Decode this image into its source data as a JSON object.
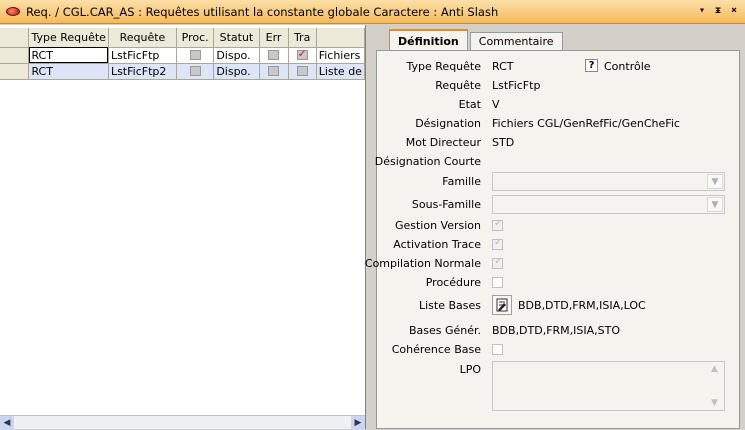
{
  "window": {
    "title": "Req. / CGL.CAR_AS : Requêtes utilisant la constante globale Caractere : Anti Slash",
    "buttons": [
      "▾",
      "ᵻ",
      "×"
    ]
  },
  "grid": {
    "columns": [
      "Type Requête",
      "Requête",
      "Proc.",
      "Statut",
      "Err",
      "Tra",
      ""
    ],
    "rows": [
      {
        "type": "RCT",
        "requete": "LstFicFtp",
        "statut": "Dispo.",
        "tra_checked": true,
        "extra": "Fichiers"
      },
      {
        "type": "RCT",
        "requete": "LstFicFtp2",
        "statut": "Dispo.",
        "tra_checked": false,
        "extra": "Liste de"
      }
    ]
  },
  "tabs": [
    "Définition",
    "Commentaire"
  ],
  "form": {
    "type_requete_label": "Type Requête",
    "type_requete_value": "RCT",
    "controle_question": "?",
    "controle_label": "Contrôle",
    "requete_label": "Requête",
    "requete_value": "LstFicFtp",
    "etat_label": "Etat",
    "etat_value": "V",
    "designation_label": "Désignation",
    "designation_value": "Fichiers CGL/GenRefFic/GenCheFic",
    "mot_directeur_label": "Mot Directeur",
    "mot_directeur_value": "STD",
    "designation_courte_label": "Désignation Courte",
    "famille_label": "Famille",
    "sous_famille_label": "Sous-Famille",
    "gestion_version_label": "Gestion Version",
    "activation_trace_label": "Activation Trace",
    "compilation_normale_label": "Compilation Normale",
    "procedure_label": "Procédure",
    "liste_bases_label": "Liste Bases",
    "liste_bases_value": "BDB,DTD,FRM,ISIA,LOC",
    "bases_gener_label": "Bases Génér.",
    "bases_gener_value": "BDB,DTD,FRM,ISIA,STO",
    "coherence_base_label": "Cohérence Base",
    "lpo_label": "LPO"
  },
  "colors": {
    "title_gradient_top": "#fce0a8",
    "title_gradient_bottom": "#f5b95c",
    "tab_accent": "#e68b2c",
    "selected_row": "#dde6f8"
  },
  "icons": [
    "app-icon",
    "question-icon",
    "list-bases-icon",
    "chevron-down-icon",
    "scroll-left-icon",
    "scroll-right-icon"
  ]
}
